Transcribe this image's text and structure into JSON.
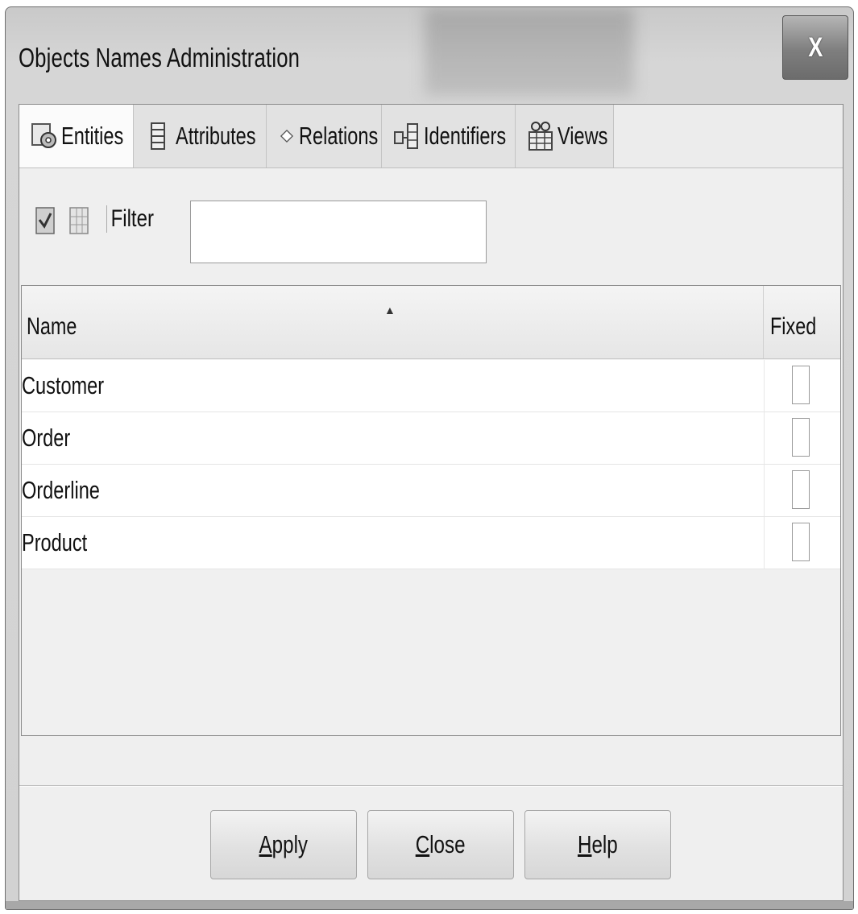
{
  "window": {
    "title": "Objects Names Administration",
    "close_label": "X"
  },
  "tabs": [
    {
      "label": "Entities",
      "icon": "entities-icon",
      "active": true
    },
    {
      "label": "Attributes",
      "icon": "attributes-icon",
      "active": false
    },
    {
      "label": "Relations",
      "icon": "relations-icon",
      "active": false
    },
    {
      "label": "Identifiers",
      "icon": "identifiers-icon",
      "active": false
    },
    {
      "label": "Views",
      "icon": "views-icon",
      "active": false
    }
  ],
  "toolbar": {
    "filter_label": "Filter",
    "filter_value": ""
  },
  "table": {
    "columns": [
      "Name",
      "Fixed"
    ],
    "sort_indicator": "▲",
    "rows": [
      {
        "name": "Customer",
        "fixed": false
      },
      {
        "name": "Order",
        "fixed": false
      },
      {
        "name": "Orderline",
        "fixed": false
      },
      {
        "name": "Product",
        "fixed": false
      }
    ]
  },
  "buttons": {
    "apply": {
      "mnemonic": "A",
      "rest": "pply"
    },
    "close": {
      "mnemonic": "C",
      "rest": "lose"
    },
    "help": {
      "mnemonic": "H",
      "rest": "elp"
    }
  }
}
